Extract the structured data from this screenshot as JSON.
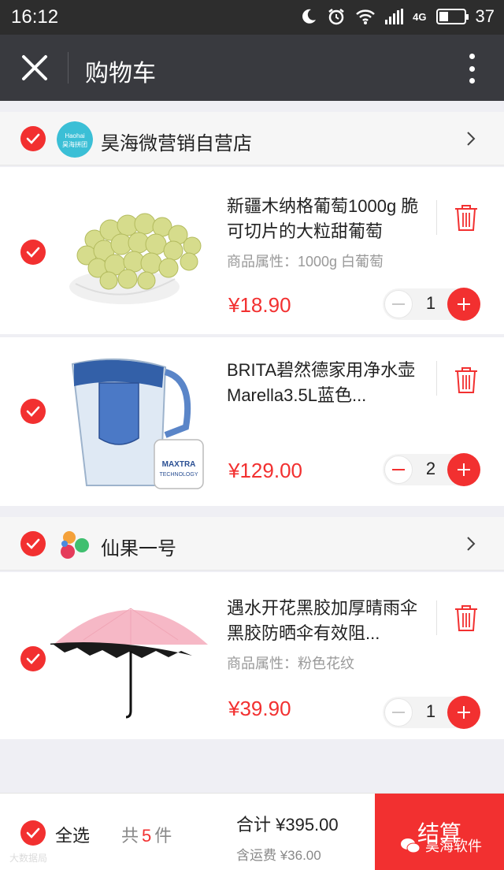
{
  "status_bar": {
    "time": "16:12",
    "network": "4G",
    "battery": "37",
    "battery_level": 0.37
  },
  "header": {
    "title": "购物车"
  },
  "stores": [
    {
      "name": "昊海微营销自营店",
      "logo_text": "Haohai昊海拼团",
      "items": [
        {
          "name": "新疆木纳格葡萄1000g 脆可切片的大粒甜葡萄",
          "attr": "商品属性：1000g  白葡萄",
          "price": "¥18.90",
          "qty": "1",
          "image": "green-grapes"
        },
        {
          "name": "BRITA碧然德家用净水壶Marella3.5L蓝色...",
          "attr": "",
          "price": "¥129.00",
          "qty": "2",
          "image": "water-filter-pitcher",
          "image_text": "MAXTRA TECHNOLOGY"
        }
      ]
    },
    {
      "name": "仙果一号",
      "items": [
        {
          "name": "遇水开花黑胶加厚晴雨伞黑胶防晒伞有效阻...",
          "attr": "商品属性：粉色花纹",
          "price": "¥39.90",
          "qty": "1",
          "image": "pink-umbrella"
        }
      ]
    }
  ],
  "footer": {
    "select_all": "全选",
    "count_prefix": "共",
    "count": "5",
    "count_suffix": "件",
    "total": "合计 ¥395.00",
    "shipping": "含运费 ¥36.00",
    "checkout": "结算"
  },
  "watermark": {
    "brand": "昊海软件",
    "corner": "大数据局"
  },
  "colors": {
    "accent": "#f23030",
    "header_bg": "#393a3f",
    "statusbar_bg": "#2d2d2d"
  }
}
